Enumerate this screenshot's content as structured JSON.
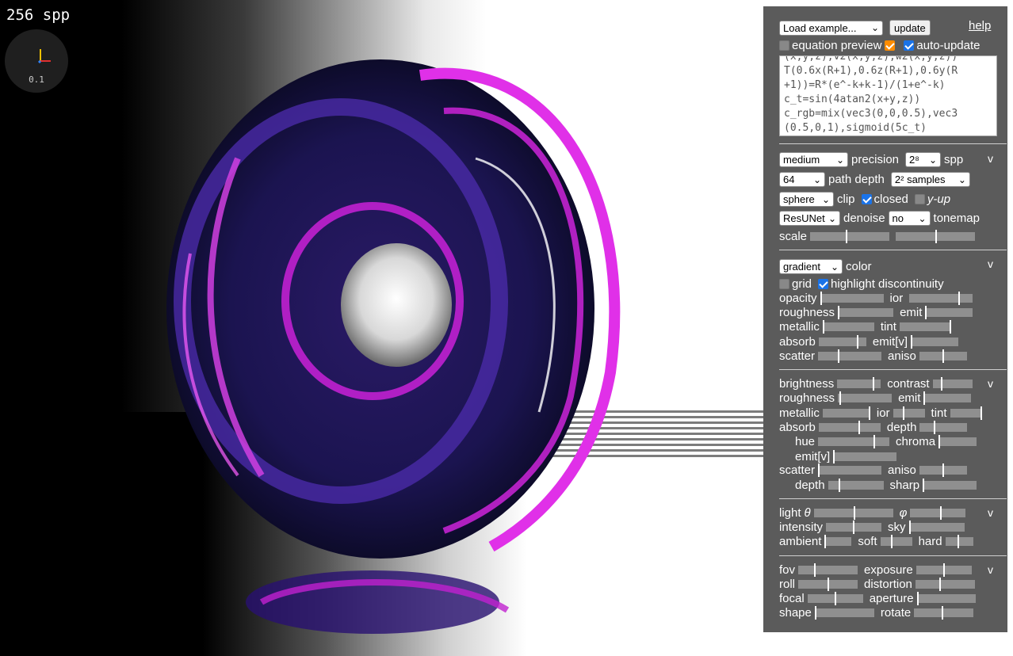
{
  "viewport": {
    "spp_label": "256 spp",
    "gizmo_scale": "0.1"
  },
  "header": {
    "load_example": "Load example...",
    "update": "update",
    "help": "help",
    "equation_preview": "equation preview",
    "auto_update": "auto-update",
    "equation_lines": [
      "(x,y,z),v2(x,y,z),w2(x,y,z))",
      "T(0.6x(R+1),0.6z(R+1),0.6y(R",
      "+1))=R*(e^-k+k-1)/(1+e^-k)",
      "c_t=sin(4atan2(x+y,z))",
      "c_rgb=mix(vec3(0,0,0.5),vec3",
      "(0.5,0,1),sigmoid(5c_t)"
    ]
  },
  "render": {
    "precision_value": "medium",
    "precision_label": "precision",
    "spp_value": "2⁸",
    "spp_label": "spp",
    "depth_value": "64",
    "depth_label": "path depth",
    "samples_value": "2² samples",
    "clip_value": "sphere",
    "clip_label": "clip",
    "closed_label": "closed",
    "yup_label": "y-up",
    "denoise_value": "ResUNet",
    "denoise_label": "denoise",
    "tonemap_value": "no",
    "tonemap_label": "tonemap",
    "scale_label": "scale",
    "collapse": "v"
  },
  "material": {
    "color_value": "gradient",
    "color_label": "color",
    "grid_label": "grid",
    "highlight_label": "highlight discontinuity",
    "opacity": "opacity",
    "ior": "ior",
    "roughness": "roughness",
    "emit": "emit",
    "metallic": "metallic",
    "tint": "tint",
    "absorb": "absorb",
    "emit_v": "emit[v]",
    "scatter": "scatter",
    "aniso": "aniso",
    "collapse": "v"
  },
  "surface": {
    "brightness": "brightness",
    "contrast": "contrast",
    "roughness": "roughness",
    "emit": "emit",
    "metallic": "metallic",
    "ior": "ior",
    "tint": "tint",
    "absorb": "absorb",
    "depth": "depth",
    "hue": "hue",
    "chroma": "chroma",
    "emit_v": "emit[v]",
    "scatter": "scatter",
    "aniso": "aniso",
    "depth2": "depth",
    "sharp": "sharp",
    "collapse": "v"
  },
  "light": {
    "theta_label": "light",
    "theta_sym": "θ",
    "phi_sym": "φ",
    "intensity": "intensity",
    "sky": "sky",
    "ambient": "ambient",
    "soft": "soft",
    "hard": "hard",
    "collapse": "v"
  },
  "camera": {
    "fov": "fov",
    "exposure": "exposure",
    "roll": "roll",
    "distortion": "distortion",
    "focal": "focal",
    "aperture": "aperture",
    "shape": "shape",
    "rotate": "rotate",
    "collapse": "v"
  }
}
